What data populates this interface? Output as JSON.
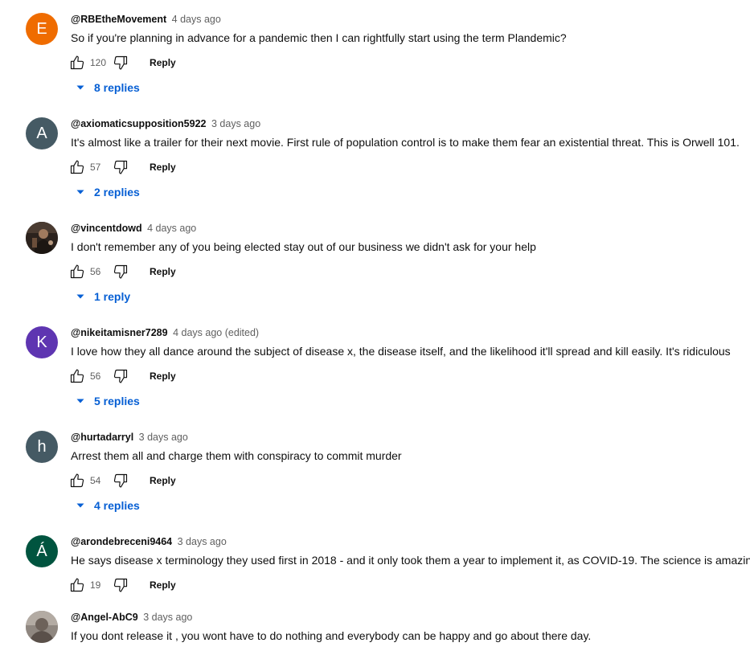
{
  "comments": [
    {
      "avatar_letter": "E",
      "avatar_color": "#ef6c00",
      "author": "@RBEtheMovement",
      "time": "4 days ago",
      "text": "So if you're planning in advance for a pandemic then I can rightfully start using the term Plandemic?",
      "likes": "120",
      "reply_label": "Reply",
      "replies_label": "8 replies"
    },
    {
      "avatar_letter": "A",
      "avatar_color": "#455a64",
      "author": "@axiomaticsupposition5922",
      "time": "3 days ago",
      "text": "It's almost like a trailer for their next movie. First rule of population control is to make them fear an existential threat. This is Orwell 101.",
      "likes": "57",
      "reply_label": "Reply",
      "replies_label": "2 replies"
    },
    {
      "avatar_photo": "vincentdowd-avatar-photo",
      "avatar_color": "#3a2e28",
      "author": "@vincentdowd",
      "time": "4 days ago",
      "text": "I don't remember any of you being elected stay out of our business we didn't ask for your help",
      "likes": "56",
      "reply_label": "Reply",
      "replies_label": "1 reply"
    },
    {
      "avatar_letter": "K",
      "avatar_color": "#5e35b1",
      "author": "@nikeitamisner7289",
      "time": "4 days ago (edited)",
      "text": "I love how they all dance around the subject of disease x, the disease itself, and the likelihood it'll spread and kill easily. It's ridiculous",
      "likes": "56",
      "reply_label": "Reply",
      "replies_label": "5 replies"
    },
    {
      "avatar_letter": "h",
      "avatar_color": "#455a64",
      "author": "@hurtadarryl",
      "time": "3 days ago",
      "text": "Arrest them all and charge them with conspiracy to commit murder",
      "likes": "54",
      "reply_label": "Reply",
      "replies_label": "4 replies"
    },
    {
      "avatar_letter": "Á",
      "avatar_color": "#00543f",
      "author": "@arondebreceni9464",
      "time": "3 days ago",
      "text": "He says disease x terminology they used first in 2018 - and it only took them a year to implement it, as COVID-19. The science is amazing",
      "likes": "19",
      "reply_label": "Reply"
    },
    {
      "avatar_photo": "angel-abc9-avatar-photo",
      "avatar_color": "#9a9088",
      "author": "@Angel-AbC9",
      "time": "3 days ago",
      "text": "If you dont release it , you wont have to do nothing and everybody can be happy and go about there day."
    }
  ],
  "icons": {
    "like": "thumb-up-icon",
    "dislike": "thumb-down-icon",
    "expand": "chevron-down-icon"
  },
  "colors": {
    "link_blue": "#065fd4",
    "meta_gray": "#606060"
  }
}
